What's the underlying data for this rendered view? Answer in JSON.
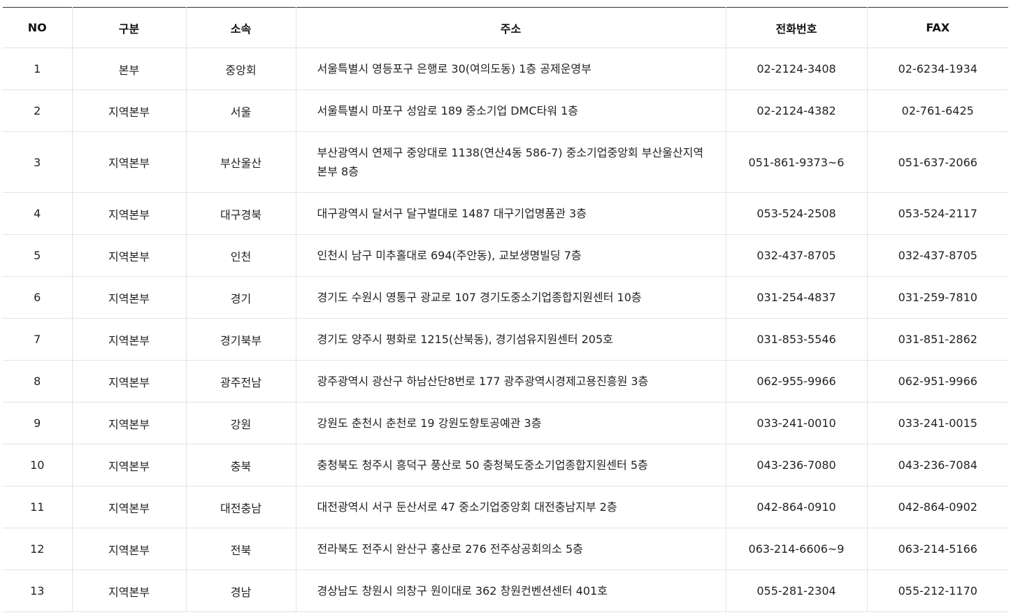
{
  "table": {
    "headers": [
      "NO",
      "구분",
      "소속",
      "주소",
      "전화번호",
      "FAX"
    ],
    "rows": [
      {
        "no": "1",
        "type": "본부",
        "org": "중앙회",
        "address": "서울특별시 영등포구 은행로 30(여의도동) 1층 공제운영부",
        "tel": "02-2124-3408",
        "fax": "02-6234-1934"
      },
      {
        "no": "2",
        "type": "지역본부",
        "org": "서울",
        "address": "서울특별시 마포구 성암로 189 중소기업 DMC타워 1층",
        "tel": "02-2124-4382",
        "fax": "02-761-6425"
      },
      {
        "no": "3",
        "type": "지역본부",
        "org": "부산울산",
        "address": "부산광역시 연제구 중앙대로 1138(연산4동 586-7) 중소기업중앙회 부산울산지역본부 8층",
        "tel": "051-861-9373~6",
        "fax": "051-637-2066"
      },
      {
        "no": "4",
        "type": "지역본부",
        "org": "대구경북",
        "address": "대구광역시 달서구 달구벌대로 1487 대구기업명품관 3층",
        "tel": "053-524-2508",
        "fax": "053-524-2117"
      },
      {
        "no": "5",
        "type": "지역본부",
        "org": "인천",
        "address": "인천시 남구 미추홀대로 694(주안동), 교보생명빌딩 7층",
        "tel": "032-437-8705",
        "fax": "032-437-8705"
      },
      {
        "no": "6",
        "type": "지역본부",
        "org": "경기",
        "address": "경기도 수원시 영통구 광교로 107 경기도중소기업종합지원센터 10층",
        "tel": "031-254-4837",
        "fax": "031-259-7810"
      },
      {
        "no": "7",
        "type": "지역본부",
        "org": "경기북부",
        "address": "경기도 양주시 평화로 1215(산북동), 경기섬유지원센터 205호",
        "tel": "031-853-5546",
        "fax": "031-851-2862"
      },
      {
        "no": "8",
        "type": "지역본부",
        "org": "광주전남",
        "address": "광주광역시 광산구 하남산단8번로 177 광주광역시경제고용진흥원 3층",
        "tel": "062-955-9966",
        "fax": "062-951-9966"
      },
      {
        "no": "9",
        "type": "지역본부",
        "org": "강원",
        "address": "강원도 춘천시 춘천로 19 강원도향토공예관 3층",
        "tel": "033-241-0010",
        "fax": "033-241-0015"
      },
      {
        "no": "10",
        "type": "지역본부",
        "org": "충북",
        "address": "충청북도 청주시 흥덕구 풍산로 50 충청북도중소기업종합지원센터 5층",
        "tel": "043-236-7080",
        "fax": "043-236-7084"
      },
      {
        "no": "11",
        "type": "지역본부",
        "org": "대전충남",
        "address": "대전광역시 서구 둔산서로 47 중소기업중앙회 대전충남지부 2층",
        "tel": "042-864-0910",
        "fax": "042-864-0902"
      },
      {
        "no": "12",
        "type": "지역본부",
        "org": "전북",
        "address": "전라북도 전주시 완산구 홍산로 276 전주상공회의소 5층",
        "tel": "063-214-6606~9",
        "fax": "063-214-5166"
      },
      {
        "no": "13",
        "type": "지역본부",
        "org": "경남",
        "address": "경상남도 창원시 의창구 원이대로 362 창원컨벤션센터 401호",
        "tel": "055-281-2304",
        "fax": "055-212-1170"
      }
    ]
  }
}
